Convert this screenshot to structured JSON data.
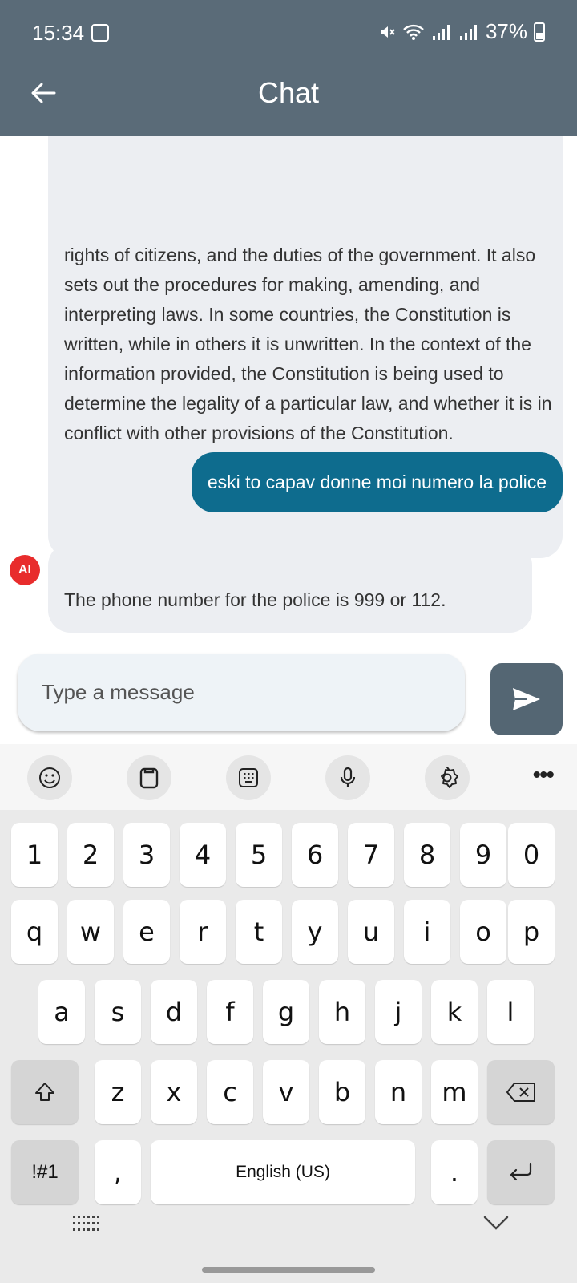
{
  "status_bar": {
    "time": "15:34",
    "battery": "37%"
  },
  "header": {
    "title": "Chat"
  },
  "messages": [
    {
      "sender": "ai",
      "text": "rights of citizens, and the duties of the government. It also sets out the procedures for making, amending, and interpreting laws. In some countries, the Constitution is written, while in others it is unwritten. In the context of the information provided, the Constitution is being used to determine the legality of a particular law, and whether it is in conflict with other provisions of the Constitution."
    },
    {
      "sender": "user",
      "text": "eski to capav donne moi numero la police"
    },
    {
      "sender": "ai",
      "avatar": "AI",
      "text": "The phone number for the police is 999 or 112."
    }
  ],
  "composer": {
    "placeholder": "Type a message",
    "send_icon": "send-icon"
  },
  "keyboard": {
    "toolbar_icons": [
      "emoji-icon",
      "clipboard-icon",
      "keypad-icon",
      "mic-icon",
      "settings-icon",
      "more-icon"
    ],
    "more_label": "•••",
    "number_row": [
      "1",
      "2",
      "3",
      "4",
      "5",
      "6",
      "7",
      "8",
      "9",
      "0"
    ],
    "row1": [
      "q",
      "w",
      "e",
      "r",
      "t",
      "y",
      "u",
      "i",
      "o",
      "p"
    ],
    "row2": [
      "a",
      "s",
      "d",
      "f",
      "g",
      "h",
      "j",
      "k",
      "l"
    ],
    "row3": [
      "z",
      "x",
      "c",
      "v",
      "b",
      "n",
      "m"
    ],
    "symbols_label": "!#1",
    "comma": ",",
    "space_label": "English (US)",
    "period": "."
  },
  "colors": {
    "app_bar": "#5a6b78",
    "user_bubble": "#0e6c8e",
    "ai_bubble": "#eceef2",
    "send_button": "#546673",
    "ai_avatar": "#e82c2c"
  }
}
